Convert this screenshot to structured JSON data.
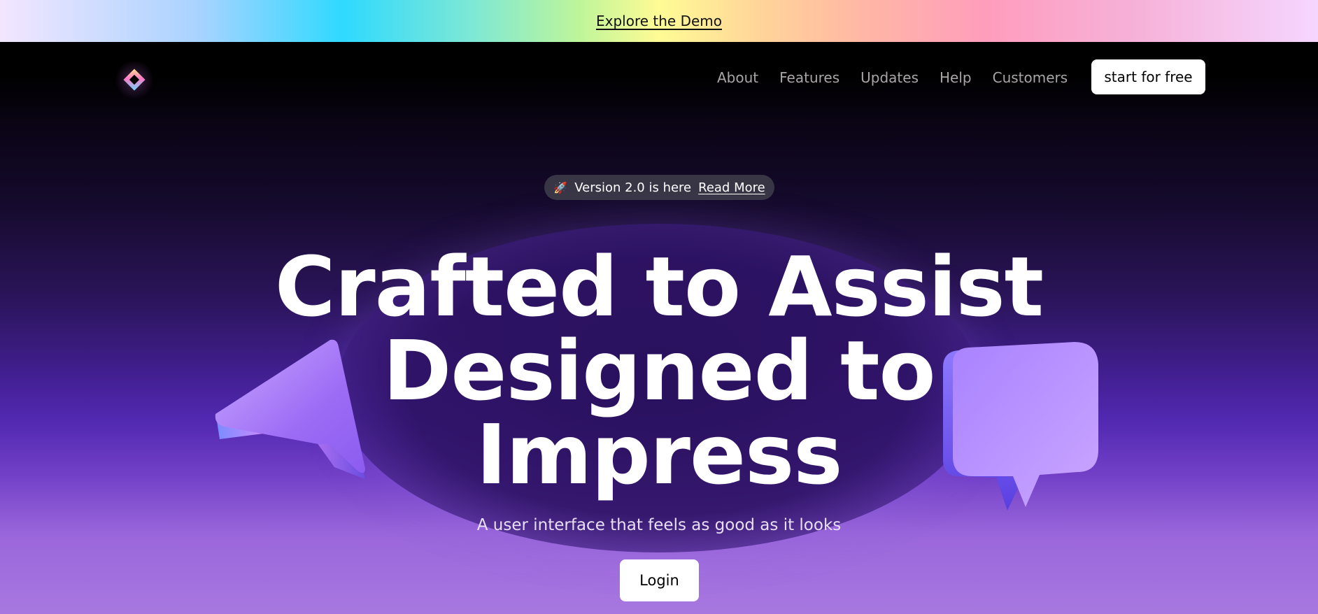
{
  "banner": {
    "link_label": "Explore the Demo"
  },
  "nav": {
    "items": [
      {
        "label": "About"
      },
      {
        "label": "Features"
      },
      {
        "label": "Updates"
      },
      {
        "label": "Help"
      },
      {
        "label": "Customers"
      }
    ],
    "cta_label": "start for free"
  },
  "announcement": {
    "icon": "rocket-icon",
    "text": "Version 2.0 is here",
    "link_label": "Read More"
  },
  "hero": {
    "headline_lines": [
      "Crafted to Assist",
      "Designed to",
      "Impress"
    ],
    "subtitle": "A user interface that feels as good as it looks",
    "login_label": "Login"
  },
  "colors": {
    "banner_gradient": [
      "#f3e6ff",
      "#2fd9ff",
      "#fffb95",
      "#ff9dbd",
      "#f5d6ff"
    ],
    "hero_bottom": "#a878e0",
    "accent_purple": "#5128b0",
    "button_bg": "#ffffff"
  }
}
